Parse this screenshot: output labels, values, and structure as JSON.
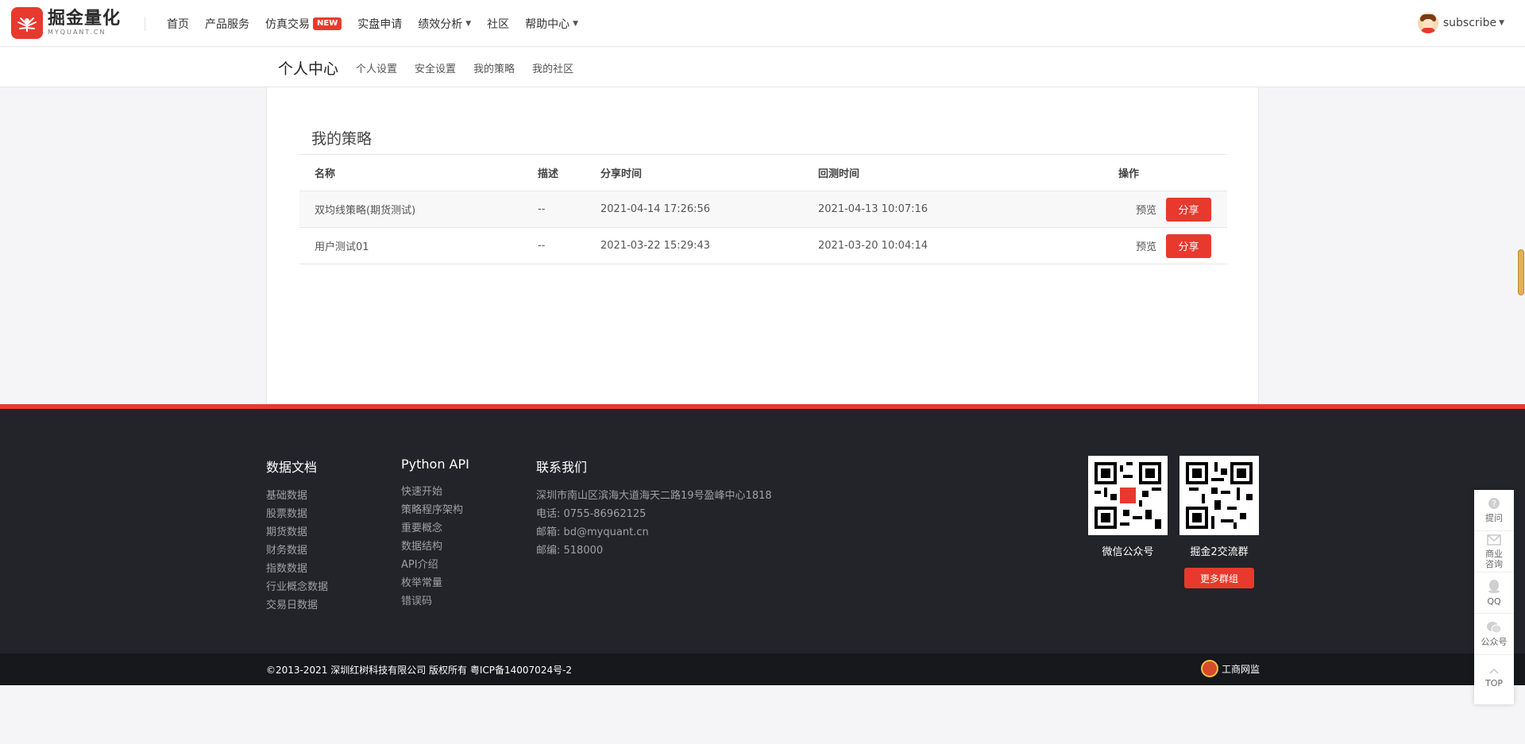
{
  "header": {
    "logo_name": "掘金量化",
    "logo_sub": "MYQUANT.CN",
    "nav": [
      {
        "label": "首页"
      },
      {
        "label": "产品服务"
      },
      {
        "label": "仿真交易",
        "badge": "NEW"
      },
      {
        "label": "实盘申请"
      },
      {
        "label": "绩效分析",
        "has_dropdown": true
      },
      {
        "label": "社区"
      },
      {
        "label": "帮助中心",
        "has_dropdown": true
      }
    ],
    "user": {
      "name": "subscribe"
    }
  },
  "subnav": {
    "title": "个人中心",
    "items": [
      {
        "label": "个人设置"
      },
      {
        "label": "安全设置"
      },
      {
        "label": "我的策略"
      },
      {
        "label": "我的社区"
      }
    ]
  },
  "strategies": {
    "title": "我的策略",
    "columns": {
      "name": "名称",
      "desc": "描述",
      "share_time": "分享时间",
      "backtest_time": "回测时间",
      "ops": "操作"
    },
    "rows": [
      {
        "name": "双均线策略(期货测试)",
        "desc": "--",
        "share_time": "2021-04-14 17:26:56",
        "backtest_time": "2021-04-13 10:07:16",
        "preview": "预览",
        "share": "分享"
      },
      {
        "name": "用户测试01",
        "desc": "--",
        "share_time": "2021-03-22 15:29:43",
        "backtest_time": "2021-03-20 10:04:14",
        "preview": "预览",
        "share": "分享"
      }
    ]
  },
  "footer": {
    "docs": {
      "title": "数据文档",
      "links": [
        "基础数据",
        "股票数据",
        "期货数据",
        "财务数据",
        "指数数据",
        "行业概念数据",
        "交易日数据"
      ]
    },
    "api": {
      "title": "Python API",
      "links": [
        "快速开始",
        "策略程序架构",
        "重要概念",
        "数据结构",
        "API介绍",
        "枚举常量",
        "错误码"
      ]
    },
    "contact": {
      "title": "联系我们",
      "address": "深圳市南山区滨海大道海天二路19号盈峰中心1818",
      "phone": "电话: 0755-86962125",
      "email": "邮箱: bd@myquant.cn",
      "zip": "邮编: 518000"
    },
    "qr": [
      {
        "label": "微信公众号"
      },
      {
        "label": "掘金2交流群"
      }
    ],
    "more_groups": "更多群组",
    "copyright": "©2013-2021 深圳红树科技有限公司 版权所有 粤ICP备14007024号-2",
    "gov_label": "工商网监"
  },
  "float_toolbar": [
    {
      "label": "提问",
      "icon": "question-icon"
    },
    {
      "label": "商业\n咨询",
      "icon": "mail-icon"
    },
    {
      "label": "QQ",
      "icon": "qq-icon"
    },
    {
      "label": "公众号",
      "icon": "wechat-icon"
    },
    {
      "label": "TOP",
      "icon": "arrow-up-icon"
    }
  ],
  "colors": {
    "accent": "#e8392e",
    "footer_bg": "#222429",
    "bottombar_bg": "#17181c"
  }
}
